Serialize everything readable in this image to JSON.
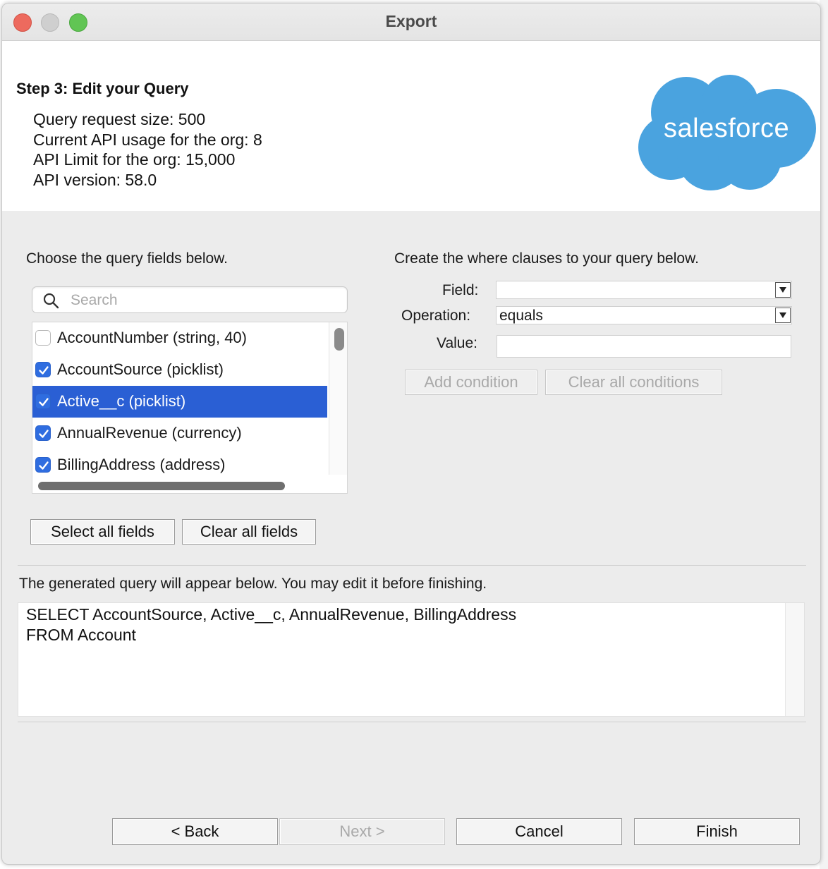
{
  "window": {
    "title": "Export"
  },
  "header": {
    "step_title": "Step 3: Edit your Query",
    "info": [
      "Query request size: 500",
      "Current API usage for the org: 8",
      "API Limit for the org: 15,000",
      "API version: 58.0"
    ],
    "logo_text": "salesforce"
  },
  "fields_panel": {
    "instruction": "Choose the query fields below.",
    "search_placeholder": "Search",
    "search_value": "",
    "items": [
      {
        "label": "AccountNumber (string, 40)",
        "checked": false,
        "selected": false
      },
      {
        "label": "AccountSource (picklist)",
        "checked": true,
        "selected": false
      },
      {
        "label": "Active__c (picklist)",
        "checked": true,
        "selected": true
      },
      {
        "label": "AnnualRevenue (currency)",
        "checked": true,
        "selected": false
      },
      {
        "label": "BillingAddress (address)",
        "checked": true,
        "selected": false
      }
    ],
    "select_all_label": "Select all fields",
    "clear_all_label": "Clear all fields"
  },
  "where_panel": {
    "instruction": "Create the where clauses to your query below.",
    "field_label": "Field:",
    "field_value": "",
    "operation_label": "Operation:",
    "operation_value": "equals",
    "value_label": "Value:",
    "value_value": "",
    "add_condition_label": "Add condition",
    "clear_conditions_label": "Clear all conditions"
  },
  "query": {
    "instruction": "The generated query will appear below.  You may edit it before finishing.",
    "text": "SELECT AccountSource, Active__c, AnnualRevenue, BillingAddress\nFROM Account"
  },
  "footer": {
    "back_label": "< Back",
    "next_label": "Next >",
    "cancel_label": "Cancel",
    "finish_label": "Finish"
  },
  "colors": {
    "selection": "#2a5fd4",
    "checkbox_on": "#2f6de0",
    "logo_blue": "#4aa3df"
  }
}
